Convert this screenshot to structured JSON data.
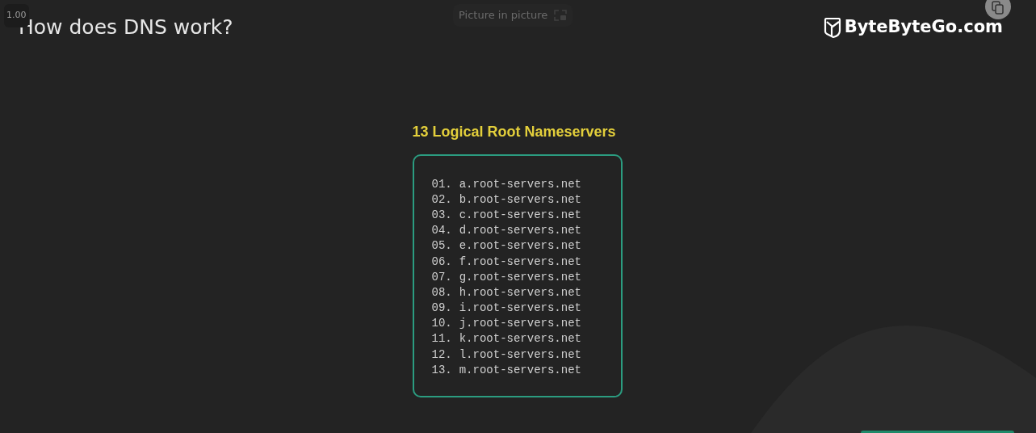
{
  "speed_badge": "1.00",
  "title": "How does DNS work?",
  "pip_button": {
    "label": "Picture in picture"
  },
  "logo": {
    "text": "ByteByteGo.com"
  },
  "panel": {
    "heading": "13 Logical Root Nameservers",
    "servers": [
      {
        "number": "01.",
        "host": "a.root-servers.net"
      },
      {
        "number": "02.",
        "host": "b.root-servers.net"
      },
      {
        "number": "03.",
        "host": "c.root-servers.net"
      },
      {
        "number": "04.",
        "host": "d.root-servers.net"
      },
      {
        "number": "05.",
        "host": "e.root-servers.net"
      },
      {
        "number": "06.",
        "host": "f.root-servers.net"
      },
      {
        "number": "07.",
        "host": "g.root-servers.net"
      },
      {
        "number": "08.",
        "host": "h.root-servers.net"
      },
      {
        "number": "09.",
        "host": "i.root-servers.net"
      },
      {
        "number": "10.",
        "host": "j.root-servers.net"
      },
      {
        "number": "11.",
        "host": "k.root-servers.net"
      },
      {
        "number": "12.",
        "host": "l.root-servers.net"
      },
      {
        "number": "13.",
        "host": "m.root-servers.net"
      }
    ]
  }
}
